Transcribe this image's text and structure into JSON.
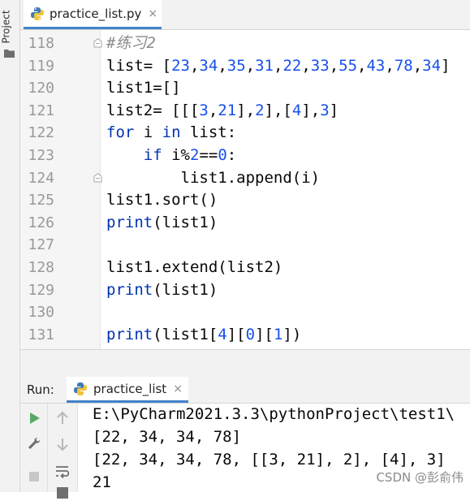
{
  "sidebar": {
    "project_label": "Project"
  },
  "editor_tab": {
    "filename": "practice_list.py",
    "close_glyph": "×"
  },
  "editor": {
    "lines": [
      {
        "number": "118",
        "tokens": [
          {
            "t": "#练习2",
            "c": "cm"
          }
        ],
        "fold": true
      },
      {
        "number": "119",
        "tokens": [
          {
            "t": "list= [",
            "c": ""
          },
          {
            "t": "23",
            "c": "num"
          },
          {
            "t": ",",
            "c": ""
          },
          {
            "t": "34",
            "c": "num"
          },
          {
            "t": ",",
            "c": ""
          },
          {
            "t": "35",
            "c": "num"
          },
          {
            "t": ",",
            "c": ""
          },
          {
            "t": "31",
            "c": "num"
          },
          {
            "t": ",",
            "c": ""
          },
          {
            "t": "22",
            "c": "num"
          },
          {
            "t": ",",
            "c": ""
          },
          {
            "t": "33",
            "c": "num"
          },
          {
            "t": ",",
            "c": ""
          },
          {
            "t": "55",
            "c": "num"
          },
          {
            "t": ",",
            "c": ""
          },
          {
            "t": "43",
            "c": "num"
          },
          {
            "t": ",",
            "c": ""
          },
          {
            "t": "78",
            "c": "num"
          },
          {
            "t": ",",
            "c": ""
          },
          {
            "t": "34",
            "c": "num"
          },
          {
            "t": "]",
            "c": ""
          }
        ]
      },
      {
        "number": "120",
        "tokens": [
          {
            "t": "list1=[]",
            "c": ""
          }
        ]
      },
      {
        "number": "121",
        "tokens": [
          {
            "t": "list2= [[[",
            "c": ""
          },
          {
            "t": "3",
            "c": "num"
          },
          {
            "t": ",",
            "c": ""
          },
          {
            "t": "21",
            "c": "num"
          },
          {
            "t": "],",
            "c": ""
          },
          {
            "t": "2",
            "c": "num"
          },
          {
            "t": "],[",
            "c": ""
          },
          {
            "t": "4",
            "c": "num"
          },
          {
            "t": "],",
            "c": ""
          },
          {
            "t": "3",
            "c": "num"
          },
          {
            "t": "]",
            "c": ""
          }
        ]
      },
      {
        "number": "122",
        "tokens": [
          {
            "t": "for",
            "c": "kw"
          },
          {
            "t": " i ",
            "c": ""
          },
          {
            "t": "in",
            "c": "kw"
          },
          {
            "t": " list:",
            "c": ""
          }
        ]
      },
      {
        "number": "123",
        "tokens": [
          {
            "t": "    ",
            "c": ""
          },
          {
            "t": "if",
            "c": "kw"
          },
          {
            "t": " i%",
            "c": ""
          },
          {
            "t": "2",
            "c": "num"
          },
          {
            "t": "==",
            "c": ""
          },
          {
            "t": "0",
            "c": "num"
          },
          {
            "t": ":",
            "c": ""
          }
        ]
      },
      {
        "number": "124",
        "tokens": [
          {
            "t": "        list1.append(i)",
            "c": ""
          }
        ],
        "fold": true
      },
      {
        "number": "125",
        "tokens": [
          {
            "t": "list1.sort()",
            "c": ""
          }
        ]
      },
      {
        "number": "126",
        "tokens": [
          {
            "t": "print",
            "c": "kw"
          },
          {
            "t": "(list1)",
            "c": ""
          }
        ]
      },
      {
        "number": "127",
        "tokens": []
      },
      {
        "number": "128",
        "tokens": [
          {
            "t": "list1.extend(list2)",
            "c": ""
          }
        ]
      },
      {
        "number": "129",
        "tokens": [
          {
            "t": "print",
            "c": "kw"
          },
          {
            "t": "(list1)",
            "c": ""
          }
        ]
      },
      {
        "number": "130",
        "tokens": []
      },
      {
        "number": "131",
        "tokens": [
          {
            "t": "print",
            "c": "kw"
          },
          {
            "t": "(list1[",
            "c": ""
          },
          {
            "t": "4",
            "c": "num"
          },
          {
            "t": "][",
            "c": ""
          },
          {
            "t": "0",
            "c": "num"
          },
          {
            "t": "][",
            "c": ""
          },
          {
            "t": "1",
            "c": "num"
          },
          {
            "t": "])",
            "c": ""
          }
        ]
      }
    ]
  },
  "run_panel": {
    "title": "Run:",
    "tab_label": "practice_list",
    "close_glyph": "×",
    "output": [
      "E:\\PyCharm2021.3.3\\pythonProject\\test1\\",
      "[22, 34, 34, 78]",
      "[22, 34, 34, 78, [[3, 21], 2], [4], 3]",
      "21"
    ]
  },
  "watermark": "CSDN @彭俞伟",
  "colors": {
    "keyword": "#0033b3",
    "number": "#1750eb",
    "comment": "#8c8c8c",
    "accent": "#4083c9"
  }
}
